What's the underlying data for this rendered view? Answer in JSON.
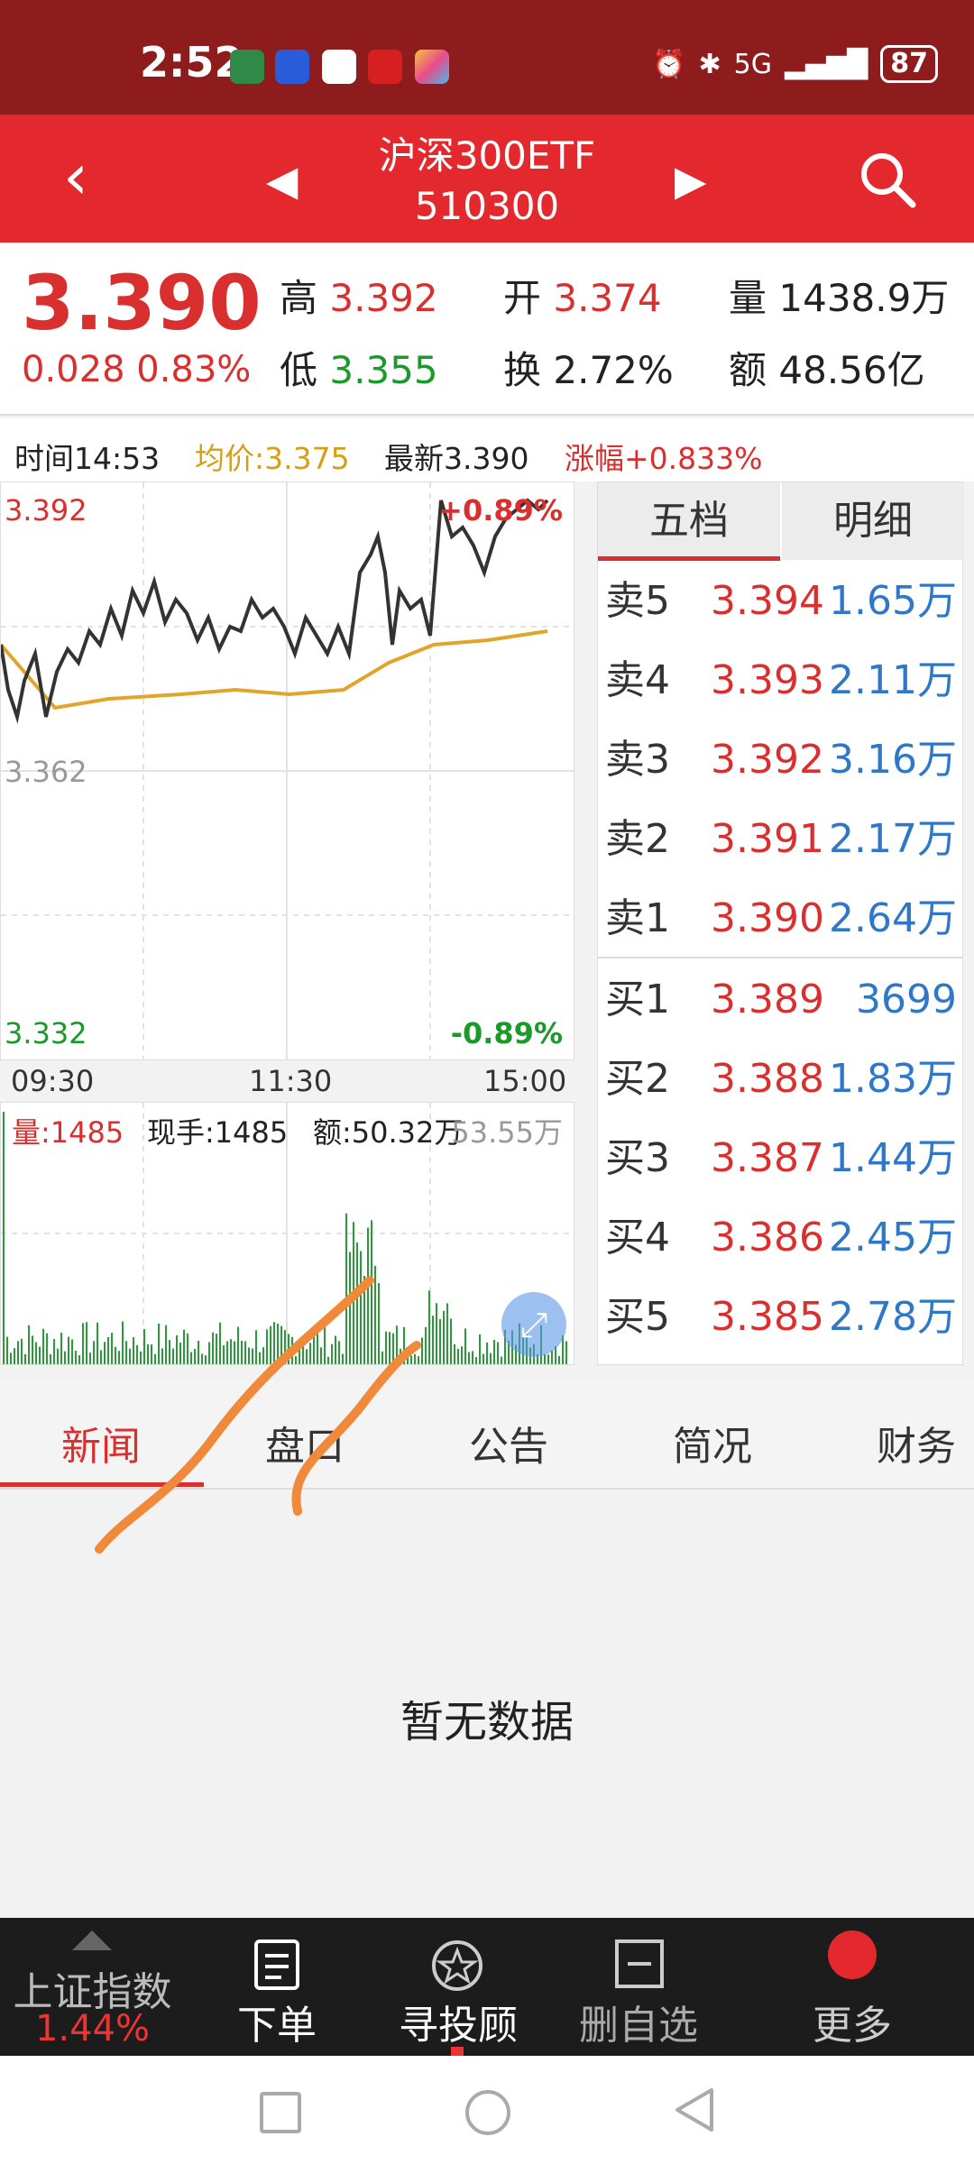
{
  "status": {
    "time": "2:52",
    "battery": "87",
    "network": "5G"
  },
  "header": {
    "title": "沪深300ETF",
    "code": "510300"
  },
  "quote": {
    "price": "3.390",
    "change": "0.028",
    "change_pct": "0.83%",
    "high_label": "高",
    "high": "3.392",
    "low_label": "低",
    "low": "3.355",
    "open_label": "开",
    "open": "3.374",
    "turnover_label": "换",
    "turnover": "2.72%",
    "volume_label": "量",
    "volume": "1438.9万",
    "amount_label": "额",
    "amount": "48.56亿"
  },
  "info": {
    "time": "时间14:53",
    "avg": "均价:3.375",
    "latest": "最新3.390",
    "pct": "涨幅+0.833%"
  },
  "chart": {
    "y_top": "3.392",
    "y_mid": "3.362",
    "y_bot": "3.332",
    "pct_top": "+0.89%",
    "pct_bot": "-0.89%",
    "t_start": "09:30",
    "t_mid": "11:30",
    "t_end": "15:00",
    "vol_label": "量:1485",
    "cur_hand": "现手:1485",
    "amount": "额:50.32万",
    "vol_max": "53.55万"
  },
  "orderbook": {
    "tabs": [
      "五档",
      "明细"
    ],
    "asks": [
      {
        "label": "卖5",
        "price": "3.394",
        "vol": "1.65万"
      },
      {
        "label": "卖4",
        "price": "3.393",
        "vol": "2.11万"
      },
      {
        "label": "卖3",
        "price": "3.392",
        "vol": "3.16万"
      },
      {
        "label": "卖2",
        "price": "3.391",
        "vol": "2.17万"
      },
      {
        "label": "卖1",
        "price": "3.390",
        "vol": "2.64万"
      }
    ],
    "bids": [
      {
        "label": "买1",
        "price": "3.389",
        "vol": "3699"
      },
      {
        "label": "买2",
        "price": "3.388",
        "vol": "1.83万"
      },
      {
        "label": "买3",
        "price": "3.387",
        "vol": "1.44万"
      },
      {
        "label": "买4",
        "price": "3.386",
        "vol": "2.45万"
      },
      {
        "label": "买5",
        "price": "3.385",
        "vol": "2.78万"
      }
    ]
  },
  "tabs": [
    "新闻",
    "盘口",
    "公告",
    "简况",
    "财务"
  ],
  "empty_text": "暂无数据",
  "toolbar": {
    "index_name": "上证指数",
    "index_pct": "1.44%",
    "order": "下单",
    "advisor": "寻投顾",
    "delete": "删自选",
    "more": "更多"
  },
  "colors": {
    "brand": "#e3282e",
    "statusbar": "#8e1c1c",
    "up": "#d9302f",
    "down": "#1a9a2a",
    "vol": "#2e78c7"
  }
}
